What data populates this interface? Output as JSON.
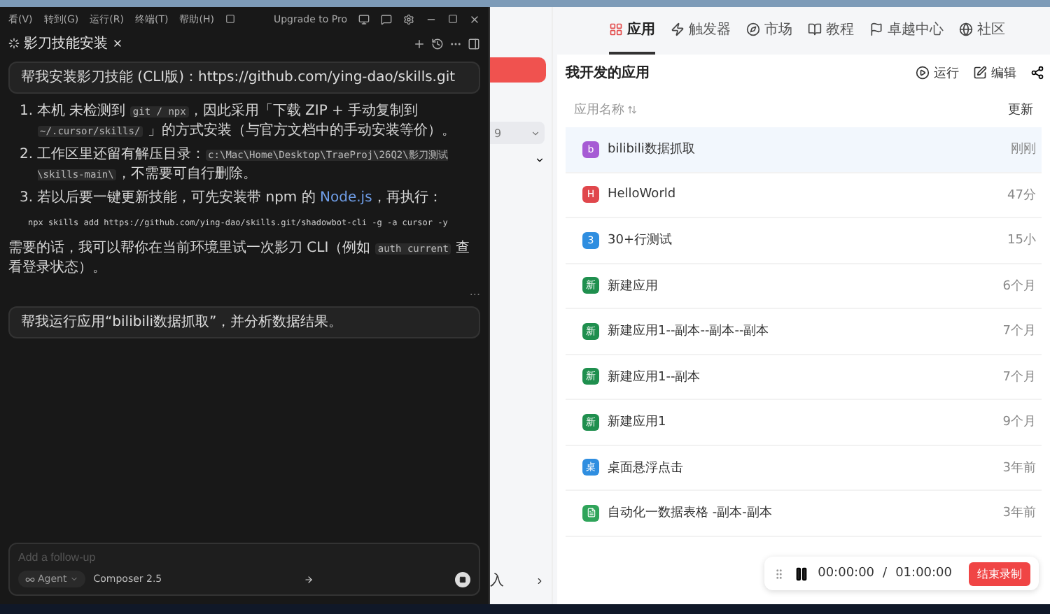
{
  "editor": {
    "menus": [
      "看(V)",
      "转到(G)",
      "运行(R)",
      "终端(T)",
      "帮助(H)"
    ],
    "upgrade": "Upgrade to Pro",
    "tab": {
      "title": "影刀技能安装",
      "selected": true
    },
    "messages": [
      {
        "kind": "user",
        "text": "帮我安装影刀技能 (CLI版)：https://github.com/ying-dao/skills.git"
      },
      {
        "kind": "assistant",
        "items": [
          {
            "marker": "1.",
            "parts": [
              {
                "kind": "text",
                "text": "本机 未检测到 "
              },
              {
                "kind": "code",
                "text": "git / npx"
              },
              {
                "kind": "text",
                "text": "，因此采用「下载 ZIP + 手动复制到 "
              },
              {
                "kind": "code",
                "text": "~/.cursor/skills/"
              },
              {
                "kind": "text",
                "text": " 」的方式安装（与官方文档中的手动安装等价）。"
              }
            ]
          },
          {
            "marker": "2.",
            "parts": [
              {
                "kind": "text",
                "text": "工作区里还留有解压目录："
              },
              {
                "kind": "code",
                "text": "c:\\Mac\\Home\\Desktop\\TraeProj\\26Q2\\影刀测试\\skills-main\\"
              },
              {
                "kind": "text",
                "text": "，不需要可自行删除。"
              }
            ]
          },
          {
            "marker": "3.",
            "parts": [
              {
                "kind": "text",
                "text": "若以后要一键更新技能，可先安装带 npm 的 "
              },
              {
                "kind": "link",
                "text": "Node.js"
              },
              {
                "kind": "text",
                "text": "，再执行："
              }
            ]
          }
        ],
        "code": "npx skills add https://github.com/ying-dao/skills.git/shadowbot-cli -g -a cursor -y",
        "paragraph": [
          {
            "kind": "text",
            "text": "需要的话，我可以帮你在当前环境里试一次影刀 CLI（例如 "
          },
          {
            "kind": "code",
            "text": "auth current"
          },
          {
            "kind": "text",
            "text": " 查看登录状态）。"
          }
        ],
        "more": "..."
      },
      {
        "kind": "user",
        "text": "帮我运行应用“bilibili数据抓取”，并分析数据结果。"
      }
    ],
    "composer": {
      "placeholder": "Add a follow-up",
      "mode": "Agent",
      "model": "Composer 2.5"
    }
  },
  "app": {
    "sidebar": {
      "select": "9",
      "bottom": "入"
    },
    "nav": [
      {
        "label": "应用",
        "selected": true
      },
      {
        "label": "触发器",
        "selected": false
      },
      {
        "label": "市场",
        "selected": false
      },
      {
        "label": "教程",
        "selected": false
      },
      {
        "label": "卓越中心",
        "selected": false
      },
      {
        "label": "社区",
        "selected": false
      }
    ],
    "panel": {
      "title": "我开发的应用",
      "actions": [
        "运行",
        "编辑"
      ]
    },
    "columns": [
      "应用名称",
      "更新"
    ],
    "rows": [
      {
        "badge": "b",
        "name": "bilibili数据抓取",
        "time": "刚刚",
        "color": "#a65bd4",
        "selected": true
      },
      {
        "badge": "H",
        "name": "HelloWorld",
        "time": "47分",
        "color": "#e0474c",
        "selected": false
      },
      {
        "badge": "3",
        "name": "30+行测试",
        "time": "15小",
        "color": "#2f8ee0",
        "selected": false
      },
      {
        "badge": "新",
        "name": "新建应用",
        "time": "6个月",
        "color": "#1f8f4e",
        "selected": false
      },
      {
        "badge": "新",
        "name": "新建应用1--副本--副本--副本",
        "time": "7个月",
        "color": "#1f8f4e",
        "selected": false
      },
      {
        "badge": "新",
        "name": "新建应用1--副本",
        "time": "7个月",
        "color": "#1f8f4e",
        "selected": false
      },
      {
        "badge": "新",
        "name": "新建应用1",
        "time": "9个月",
        "color": "#1f8f4e",
        "selected": false
      },
      {
        "badge": "桌",
        "name": "桌面悬浮点击",
        "time": "3年前",
        "color": "#2f8ee0",
        "selected": false
      },
      {
        "badge": "",
        "name": "自动化一数据表格 -副本-副本",
        "time": "3年前",
        "color": "#2fa45a",
        "selected": false
      }
    ],
    "recorder": {
      "elapsed": "00:00:00",
      "separator": "/",
      "total": "01:00:00",
      "stop": "结束录制"
    }
  }
}
